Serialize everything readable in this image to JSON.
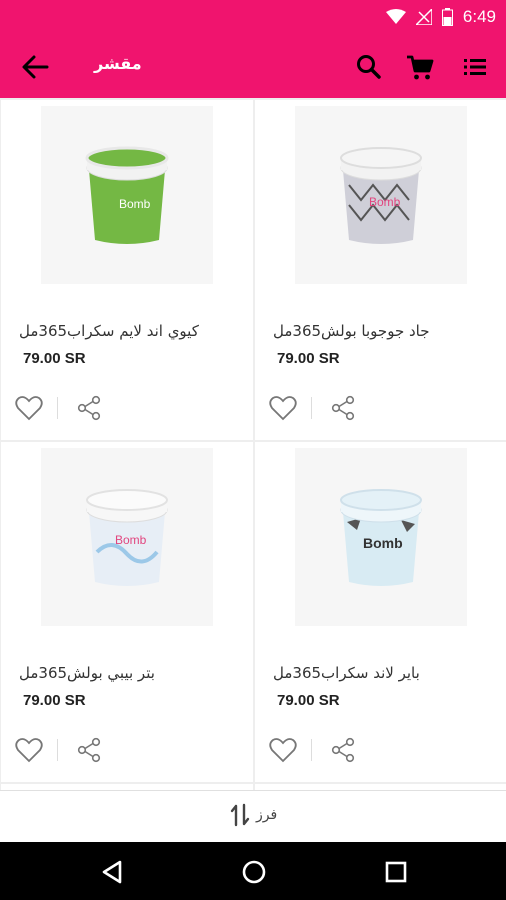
{
  "status_bar": {
    "time": "6:49"
  },
  "app_bar": {
    "title": "مقشر"
  },
  "products": [
    {
      "name": "كيوي اند لايم سكراب365مل",
      "price": "79.00 SR",
      "brand": "Bomb",
      "jar_color": "#74b844"
    },
    {
      "name": "جاد جوجوبا بولش365مل",
      "price": "79.00 SR",
      "brand": "Bomb",
      "jar_color": "#cfcfd8"
    },
    {
      "name": "بتر بيبي بولش365مل",
      "price": "79.00 SR",
      "brand": "Bomb",
      "jar_color": "#e7eef6"
    },
    {
      "name": "باير لاند سكراب365مل",
      "price": "79.00 SR",
      "brand": "Bomb",
      "jar_color": "#d8ebf3"
    }
  ],
  "sort_bar": {
    "label": "فرز"
  },
  "colors": {
    "accent": "#f0146e"
  },
  "icons": [
    "wifi-icon",
    "signal-icon",
    "battery-icon",
    "back-arrow-icon",
    "search-icon",
    "cart-icon",
    "list-menu-icon",
    "heart-icon",
    "share-icon",
    "sort-icon",
    "nav-back-icon",
    "nav-home-icon",
    "nav-recents-icon"
  ]
}
